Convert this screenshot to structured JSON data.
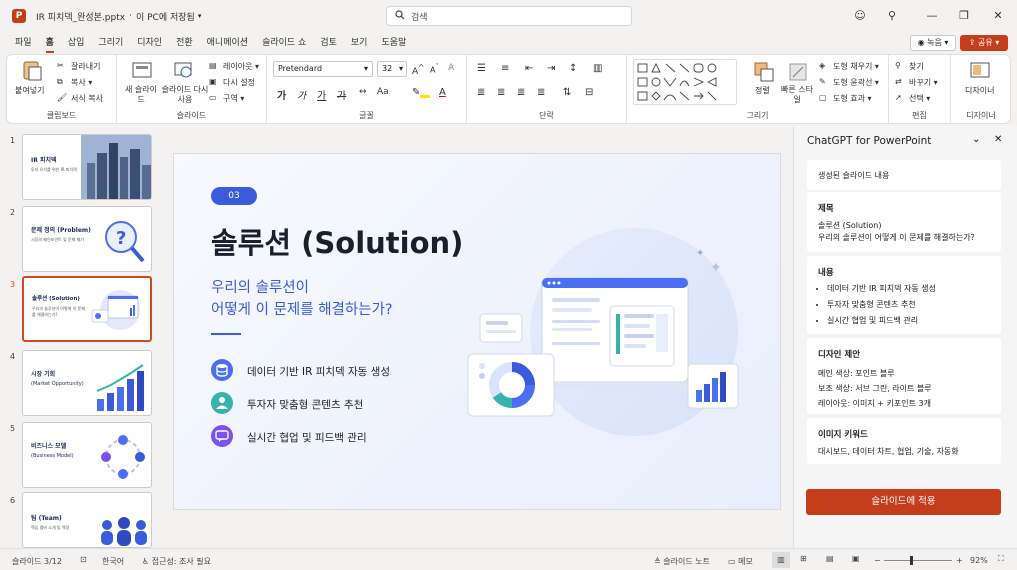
{
  "app": {
    "file_name": "IR 피치덱_완성본.pptx",
    "save_status": "이 PC에 저장됨",
    "search_placeholder": "검색"
  },
  "menu": {
    "tabs": [
      "파일",
      "홈",
      "삽입",
      "그리기",
      "디자인",
      "전환",
      "애니메이션",
      "슬라이드 쇼",
      "검토",
      "보기",
      "도움말"
    ],
    "active_tab": "홈",
    "record_label": "녹음",
    "share_label": "공유"
  },
  "ribbon": {
    "clipboard": {
      "paste": "붙여넣기",
      "cut": "잘라내기",
      "copy": "복사",
      "format_painter": "서식 복사",
      "group": "클립보드"
    },
    "slides": {
      "new_slide": "새 슬라이드",
      "reuse": "슬라이드 다시 사용",
      "layout": "레이아웃",
      "reset": "다시 설정",
      "section": "구역",
      "group": "슬라이드"
    },
    "font": {
      "family": "Pretendard",
      "size": "32",
      "group": "글꼴"
    },
    "paragraph": {
      "group": "단락"
    },
    "drawing": {
      "arrange": "정렬",
      "quick_styles": "빠른 스타일",
      "fill": "도형 채우기",
      "outline": "도형 윤곽선",
      "effects": "도형 효과",
      "group": "그리기"
    },
    "editing": {
      "find": "찾기",
      "replace": "바꾸기",
      "select": "선택",
      "group": "편집"
    },
    "designer": {
      "label": "디자이너",
      "group": "디자이너"
    }
  },
  "thumbnails": [
    {
      "num": "1",
      "title": "IR 피치덱",
      "sub": "투자 유치를 위한 IR 피치덱"
    },
    {
      "num": "2",
      "title": "문제 정의 (Problem)",
      "sub": "시장의 페인포인트 및 문제 제기"
    },
    {
      "num": "3",
      "title": "솔루션 (Solution)",
      "sub": "우리의 솔루션이 어떻게 이 문제를 해결하는가?"
    },
    {
      "num": "4",
      "title": "시장 기회",
      "sub": "(Market Opportunity)"
    },
    {
      "num": "5",
      "title": "비즈니스 모델",
      "sub": "(Business Model)"
    },
    {
      "num": "6",
      "title": "팀 (Team)",
      "sub": "핵심 멤버 소개 및 역량"
    }
  ],
  "slide": {
    "badge": "03",
    "title": "솔루션 (Solution)",
    "subtitle_line1": "우리의 솔루션이",
    "subtitle_line2": "어떻게 이 문제를 해결하는가?",
    "bullets": [
      "데이터 기반 IR 피치덱 자동 생성",
      "투자자 맞춤형 콘텐츠 추천",
      "실시간 협업 및 피드백 관리"
    ],
    "accent_color": "#3b5bdb",
    "bullet_icon_colors": [
      "#4c6ef5",
      "#38b2ac",
      "#7950f2"
    ]
  },
  "pane": {
    "title": "ChatGPT for PowerPoint",
    "section": "생성된 슬라이드 내용",
    "title_card": {
      "heading": "제목",
      "line1": "솔루션 (Solution)",
      "line2": "우리의 솔루션이 어떻게 이 문제를 해결하는가?"
    },
    "content_card": {
      "heading": "내용",
      "items": [
        "데이터 기반 IR 피치덱 자동 생성",
        "투자자 맞춤형 콘텐츠 추천",
        "실시간 협업 및 피드백 관리"
      ]
    },
    "design_card": {
      "heading": "디자인 제안",
      "items": [
        "메인 색상: 포인트 블루",
        "보조 색상: 서브 그린, 라이트 블루",
        "레이아웃: 이미지 + 키포인트 3개"
      ]
    },
    "keyword_card": {
      "heading": "이미지 키워드",
      "text": "대시보드, 데이터 차트, 협업, 기술, 자동화"
    },
    "apply_button": "슬라이드에 적용",
    "apply_color": "#c43e1c"
  },
  "status": {
    "slide": "슬라이드 3/12",
    "language": "한국어",
    "accessibility": "접근성: 조사 필요",
    "notes": "슬라이드 노트",
    "comments": "메모",
    "zoom": "92%"
  }
}
